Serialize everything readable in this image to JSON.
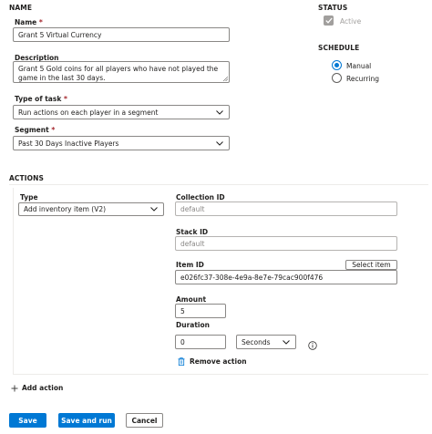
{
  "sections": {
    "name": "NAME",
    "status": "STATUS",
    "schedule": "SCHEDULE",
    "actions": "ACTIONS"
  },
  "form": {
    "name_label": "Name",
    "name_value": "Grant 5 Virtual Currency",
    "description_label": "Description",
    "description_value": "Grant 5 Gold coins for all players who have not played the game in the last 30 days.",
    "task_type_label": "Type of task",
    "task_type_value": "Run actions on each player in a segment",
    "segment_label": "Segment",
    "segment_value": "Past 30 Days Inactive Players",
    "required_mark": "*"
  },
  "status": {
    "active_label": "Active",
    "active_checked": true
  },
  "schedule": {
    "manual_label": "Manual",
    "recurring_label": "Recurring",
    "selected": "Manual"
  },
  "action": {
    "type_label": "Type",
    "type_value": "Add inventory item (V2)",
    "collection_id_label": "Collection ID",
    "collection_id_placeholder": "default",
    "stack_id_label": "Stack ID",
    "stack_id_placeholder": "default",
    "item_id_label": "Item ID",
    "item_id_value": "e026fc37-308e-4e9a-8e7e-79cac900f476",
    "select_item_label": "Select item",
    "amount_label": "Amount",
    "amount_value": "5",
    "duration_label": "Duration",
    "duration_value": "0",
    "duration_unit": "Seconds",
    "remove_label": "Remove action"
  },
  "add_action_label": "Add action",
  "buttons": {
    "save": "Save",
    "save_and_run": "Save and run",
    "cancel": "Cancel"
  },
  "colors": {
    "primary": "#0078d4",
    "required": "#a4262c"
  }
}
